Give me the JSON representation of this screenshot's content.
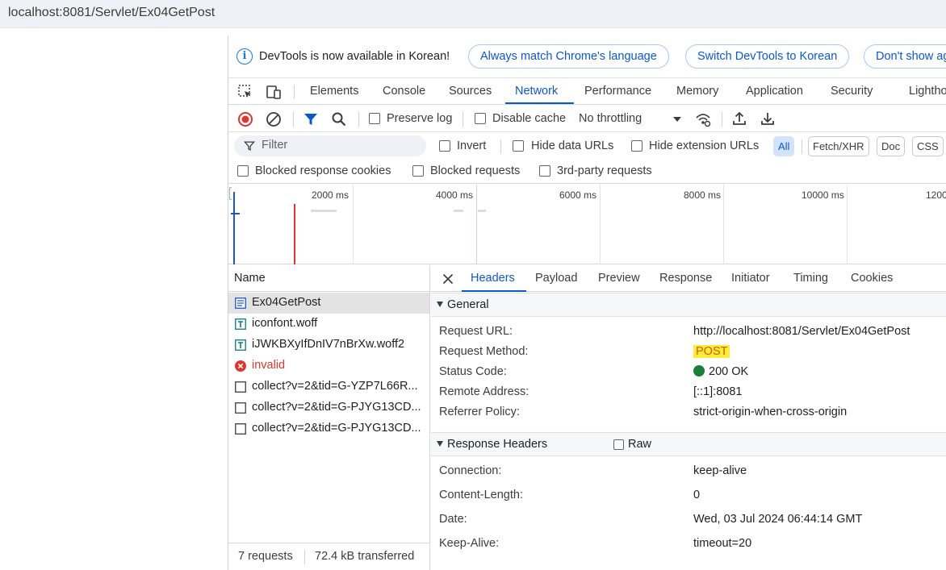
{
  "address_bar": {
    "url": "localhost:8081/Servlet/Ex04GetPost"
  },
  "infobar": {
    "message": "DevTools is now available in Korean!",
    "buttons": [
      "Always match Chrome's language",
      "Switch DevTools to Korean",
      "Don't show ag"
    ]
  },
  "panel_tabs": [
    "Elements",
    "Console",
    "Sources",
    "Network",
    "Performance",
    "Memory",
    "Application",
    "Security",
    "Lighthou"
  ],
  "active_panel_tab": "Network",
  "network_toolbar": {
    "preserve_log": "Preserve log",
    "disable_cache": "Disable cache",
    "throttling": "No throttling"
  },
  "filter_bar": {
    "filter_placeholder": "Filter",
    "invert": "Invert",
    "hide_data_urls": "Hide data URLs",
    "hide_extension_urls": "Hide extension URLs",
    "type_filters": [
      "All",
      "Fetch/XHR",
      "Doc",
      "CSS"
    ],
    "active_type": "All"
  },
  "blocked_bar": {
    "blocked_response_cookies": "Blocked response cookies",
    "blocked_requests": "Blocked requests",
    "third_party": "3rd-party requests"
  },
  "timeline": {
    "ticks": [
      "2000 ms",
      "4000 ms",
      "6000 ms",
      "8000 ms",
      "10000 ms",
      "1200"
    ]
  },
  "request_list": {
    "column": "Name",
    "rows": [
      {
        "name": "Ex04GetPost",
        "type": "document",
        "selected": true
      },
      {
        "name": "iconfont.woff",
        "type": "font"
      },
      {
        "name": "iJWKBXyIfDnIV7nBrXw.woff2",
        "type": "font"
      },
      {
        "name": "invalid",
        "type": "error"
      },
      {
        "name": "collect?v=2&tid=G-YZP7L66R...",
        "type": "other"
      },
      {
        "name": "collect?v=2&tid=G-PJYG13CD...",
        "type": "other"
      },
      {
        "name": "collect?v=2&tid=G-PJYG13CD...",
        "type": "other"
      }
    ],
    "summary": "7 requests",
    "transferred": "72.4 kB transferred"
  },
  "details": {
    "tabs": [
      "Headers",
      "Payload",
      "Preview",
      "Response",
      "Initiator",
      "Timing",
      "Cookies"
    ],
    "active_tab": "Headers",
    "general_title": "General",
    "general": [
      {
        "key": "Request URL:",
        "value": "http://localhost:8081/Servlet/Ex04GetPost"
      },
      {
        "key": "Request Method:",
        "value": "POST"
      },
      {
        "key": "Status Code:",
        "value": "200 OK"
      },
      {
        "key": "Remote Address:",
        "value": "[::1]:8081"
      },
      {
        "key": "Referrer Policy:",
        "value": "strict-origin-when-cross-origin"
      }
    ],
    "response_headers_title": "Response Headers",
    "raw_label": "Raw",
    "response_headers": [
      {
        "key": "Connection:",
        "value": "keep-alive"
      },
      {
        "key": "Content-Length:",
        "value": "0"
      },
      {
        "key": "Date:",
        "value": "Wed, 03 Jul 2024 06:44:14 GMT"
      },
      {
        "key": "Keep-Alive:",
        "value": "timeout=20"
      }
    ]
  },
  "colors": {
    "accent": "#0b57d0",
    "record": "#dc362e",
    "status_ok": "#188038",
    "method_highlight": "#ffeb3b"
  }
}
